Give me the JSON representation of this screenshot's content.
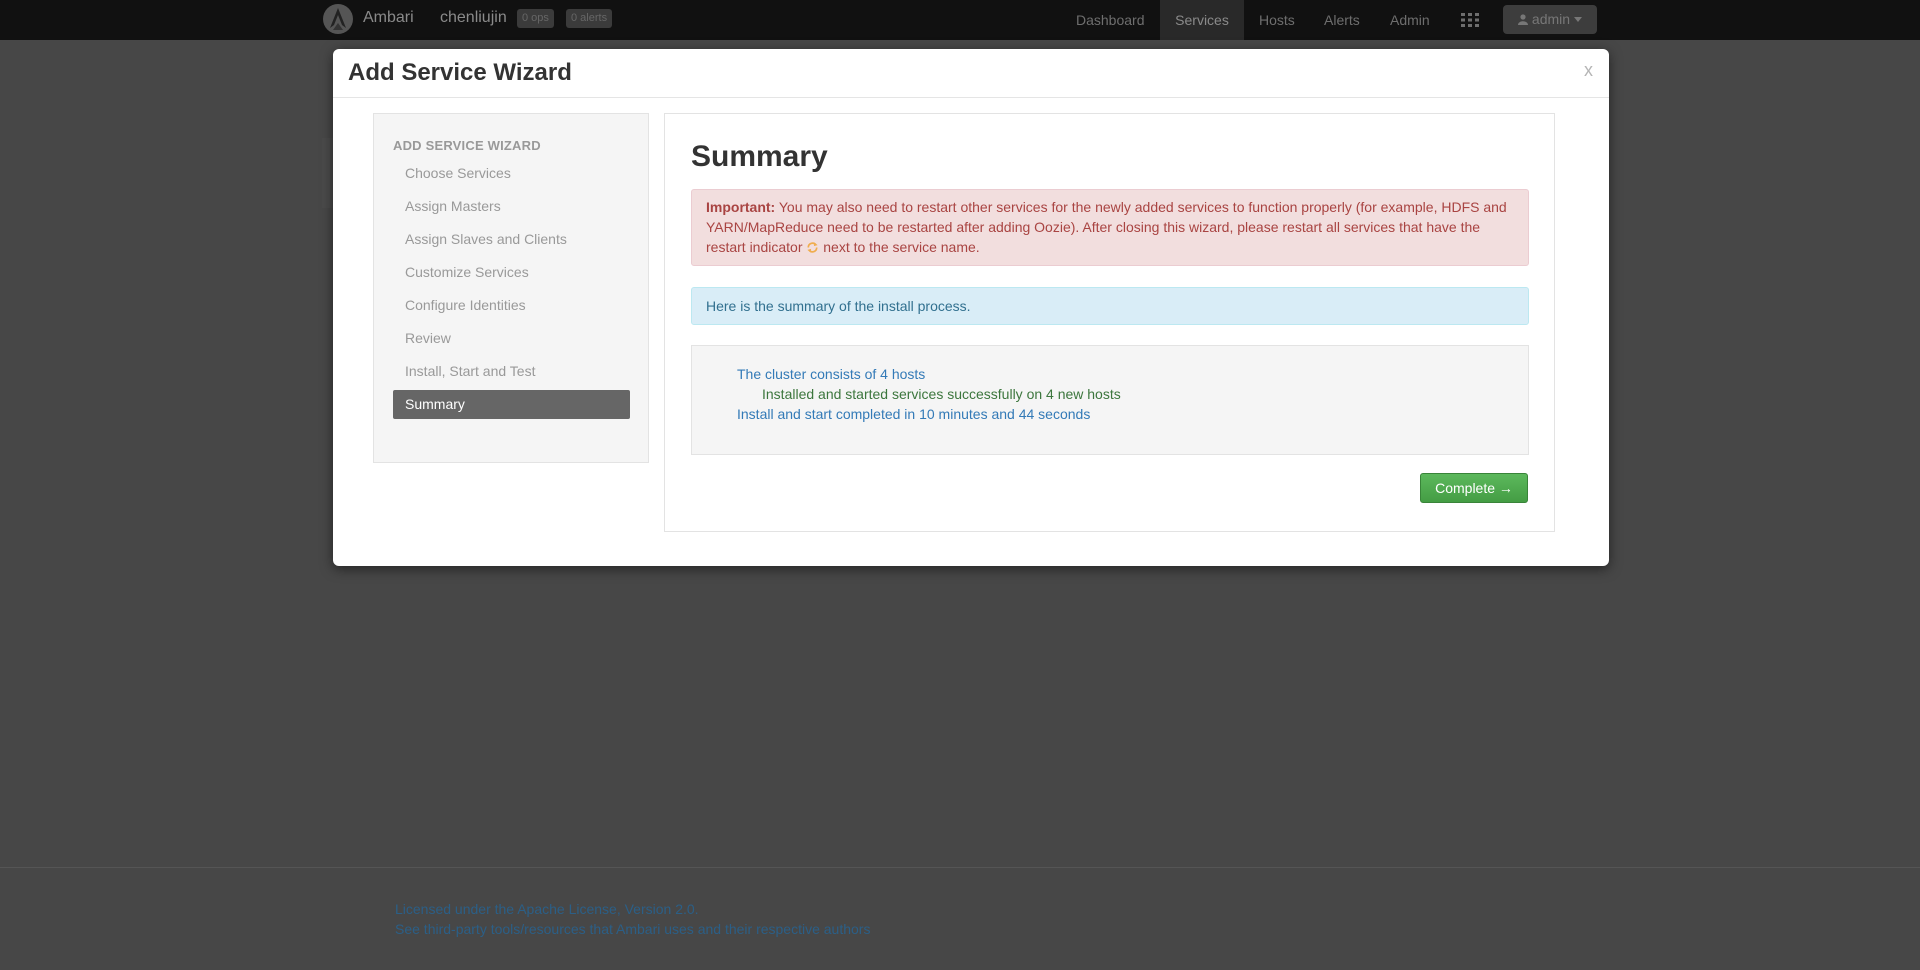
{
  "navbar": {
    "brand": "Ambari",
    "cluster_name": "chenliujin",
    "ops_badge": "0 ops",
    "alerts_badge": "0 alerts",
    "nav_items": [
      "Dashboard",
      "Services",
      "Hosts",
      "Alerts",
      "Admin"
    ],
    "active_nav": "Services",
    "user_label": "admin",
    "icons": [
      "ambari-logo-icon",
      "apps-grid-icon",
      "user-icon",
      "caret-down-icon"
    ]
  },
  "modal": {
    "title": "Add Service Wizard",
    "close_label": "x",
    "sidebar": {
      "heading": "ADD SERVICE WIZARD",
      "steps": [
        "Choose Services",
        "Assign Masters",
        "Assign Slaves and Clients",
        "Customize Services",
        "Configure Identities",
        "Review",
        "Install, Start and Test",
        "Summary"
      ],
      "active_step": "Summary"
    },
    "main": {
      "title": "Summary",
      "important_label": "Important:",
      "important_text_1": "You may also need to restart other services for the newly added services to function properly (for example, HDFS and YARN/MapReduce need to be restarted after adding Oozie). After closing this wizard, please restart all services that have the restart indicator",
      "important_text_2": "next to the service name.",
      "info_text": "Here is the summary of the install process.",
      "summary_lines": {
        "cluster": "The cluster consists of 4 hosts",
        "installed": "Installed and started services successfully on 4 new hosts",
        "duration": "Install and start completed in 10 minutes and 44 seconds"
      },
      "complete_button": "Complete →"
    }
  },
  "footer": {
    "license": "Licensed under the Apache License, Version 2.0.",
    "third_party": "See third-party tools/resources that Ambari uses and their respective authors"
  },
  "colors": {
    "danger_text": "#a94442",
    "info_text": "#31708f",
    "success_text": "#3c763d",
    "link": "#337ab7",
    "button_success": "#5cb85c",
    "restart_icon": "#f0ad4e"
  }
}
